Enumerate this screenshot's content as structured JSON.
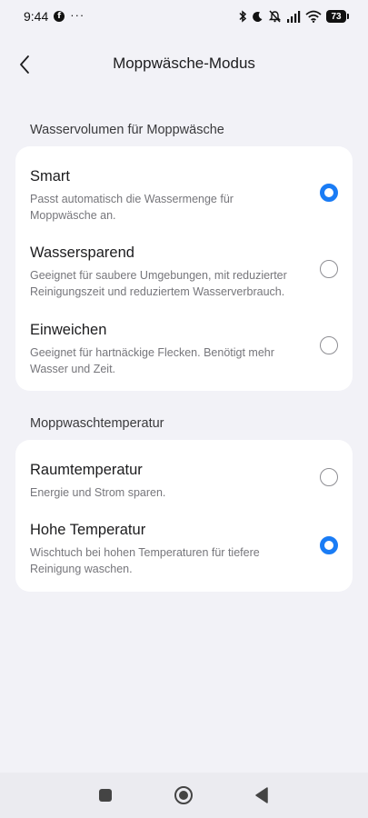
{
  "status_bar": {
    "time": "9:44",
    "facebook_glyph": "f",
    "more": "···",
    "battery": "73"
  },
  "header": {
    "title": "Moppwäsche-Modus"
  },
  "water_section": {
    "title": "Wasservolumen für Moppwäsche",
    "options": [
      {
        "title": "Smart",
        "description": "Passt automatisch die Wassermenge für Moppwäsche an.",
        "selected": true
      },
      {
        "title": "Wassersparend",
        "description": "Geeignet für saubere Umgebungen, mit reduzierter Reinigungszeit und reduziertem Wasserverbrauch.",
        "selected": false
      },
      {
        "title": "Einweichen",
        "description": "Geeignet für hartnäckige Flecken. Benötigt mehr Wasser und Zeit.",
        "selected": false
      }
    ]
  },
  "temp_section": {
    "title": "Moppwaschtemperatur",
    "options": [
      {
        "title": "Raumtemperatur",
        "description": "Energie und Strom sparen.",
        "selected": false
      },
      {
        "title": "Hohe Temperatur",
        "description": "Wischtuch bei hohen Temperaturen für tiefere Reinigung waschen.",
        "selected": true
      }
    ]
  },
  "colors": {
    "accent": "#1a7cf5",
    "background": "#f2f2f7",
    "card": "#ffffff"
  },
  "icons": [
    "back-arrow-icon",
    "bluetooth-icon",
    "moon-icon",
    "mute-icon",
    "signal-icon",
    "wifi-icon",
    "battery-icon",
    "nav-home-square-icon",
    "nav-circle-icon",
    "nav-back-triangle-icon"
  ]
}
